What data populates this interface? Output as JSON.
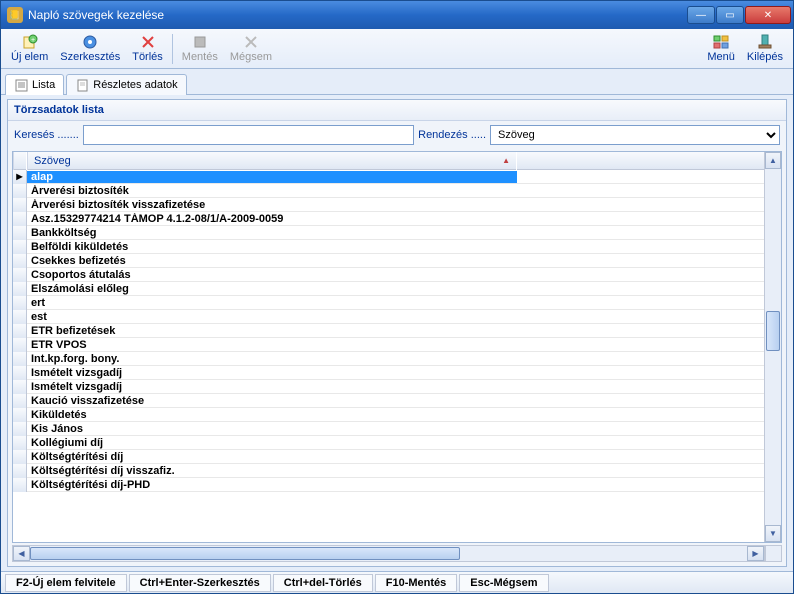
{
  "window": {
    "title": "Napló szövegek kezelése"
  },
  "toolbar": {
    "new": "Új elem",
    "edit": "Szerkesztés",
    "delete": "Törlés",
    "save": "Mentés",
    "cancel": "Mégsem",
    "menu": "Menü",
    "exit": "Kilépés"
  },
  "tabs": {
    "list": "Lista",
    "detail": "Részletes adatok"
  },
  "panel": {
    "title": "Törzsadatok lista",
    "search_label": "Keresés .......",
    "sort_label": "Rendezés .....",
    "sort_value": "Szöveg",
    "column0": "Szöveg"
  },
  "rows": [
    "alap",
    "Árverési biztosíték",
    "Árverési biztosíték visszafizetése",
    "Asz.15329774214 TÁMOP 4.1.2-08/1/A-2009-0059",
    "Bankköltség",
    "Belföldi kiküldetés",
    "Csekkes befizetés",
    "Csoportos átutalás",
    "Elszámolási előleg",
    "ert",
    "est",
    "ETR befizetések",
    "ETR VPOS",
    "Int.kp.forg. bony.",
    "Ismételt vizsgadíj",
    "Ismételt vizsgadíj",
    "Kaució visszafizetése",
    "Kiküldetés",
    "Kis János",
    "Kollégiumi díj",
    "Költségtérítési díj",
    "Költségtérítési díj visszafiz.",
    "Költségtérítési díj-PHD"
  ],
  "status": {
    "f2": "F2-Új elem felvitele",
    "ctrlenter": "Ctrl+Enter-Szerkesztés",
    "ctrldel": "Ctrl+del-Törlés",
    "f10": "F10-Mentés",
    "esc": "Esc-Mégsem"
  }
}
